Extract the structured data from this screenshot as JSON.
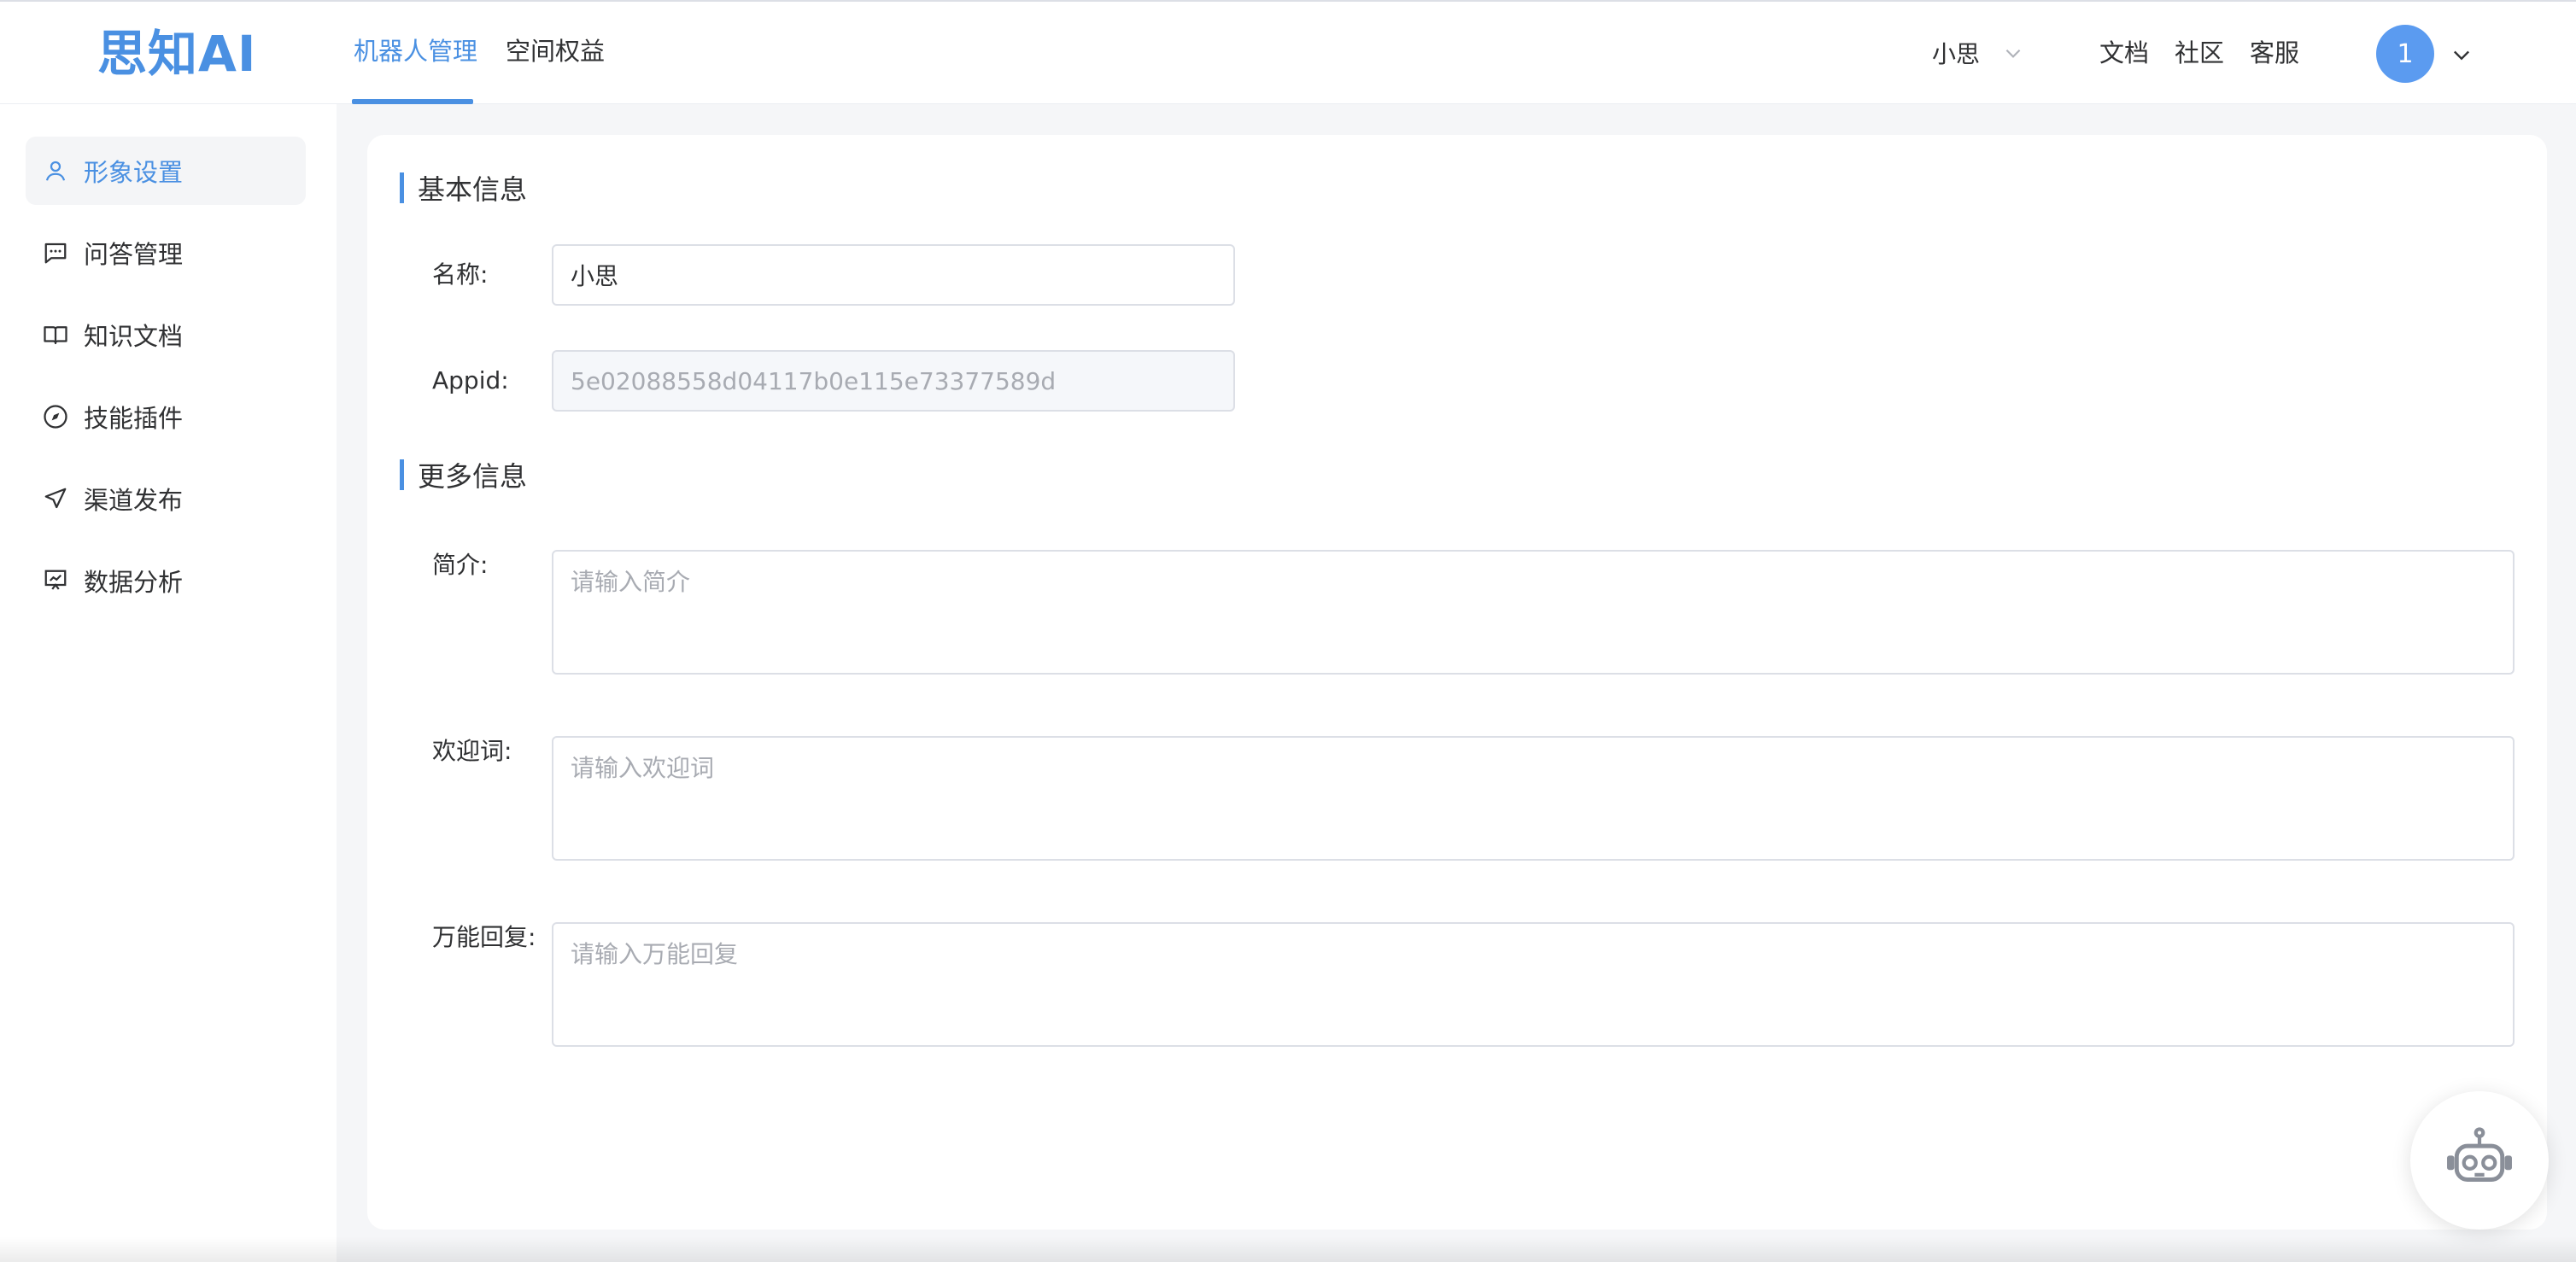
{
  "header": {
    "logo": "思知AI",
    "tabs": [
      {
        "label": "机器人管理",
        "active": true
      },
      {
        "label": "空间权益",
        "active": false
      }
    ],
    "space_select": "小思",
    "links": [
      "文档",
      "社区",
      "客服"
    ],
    "avatar_text": "1"
  },
  "sidebar": {
    "items": [
      {
        "label": "形象设置",
        "icon": "user-icon",
        "active": true
      },
      {
        "label": "问答管理",
        "icon": "chat-icon",
        "active": false
      },
      {
        "label": "知识文档",
        "icon": "book-icon",
        "active": false
      },
      {
        "label": "技能插件",
        "icon": "compass-icon",
        "active": false
      },
      {
        "label": "渠道发布",
        "icon": "send-icon",
        "active": false
      },
      {
        "label": "数据分析",
        "icon": "chart-board-icon",
        "active": false
      }
    ]
  },
  "main": {
    "basic_section": "基本信息",
    "name_label": "名称:",
    "name_value": "小思",
    "appid_label": "Appid:",
    "appid_value": "5e02088558d04117b0e115e73377589d",
    "more_section": "更多信息",
    "intro_label": "简介:",
    "intro_placeholder": "请输入简介",
    "welcome_label": "欢迎词:",
    "welcome_placeholder": "请输入欢迎词",
    "fallback_label": "万能回复:",
    "fallback_placeholder": "请输入万能回复"
  },
  "colors": {
    "accent": "#4a90e2",
    "avatar": "#5b9bf0",
    "content_bg": "#f5f6f8"
  }
}
